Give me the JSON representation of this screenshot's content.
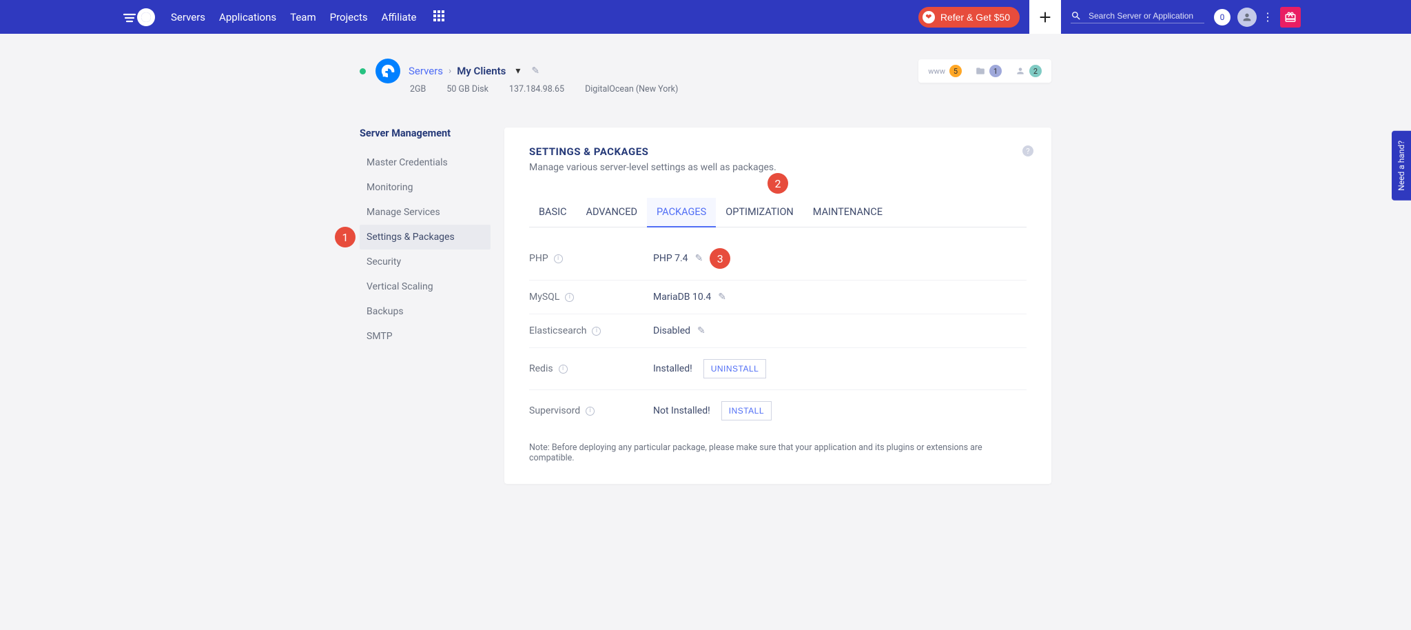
{
  "nav": {
    "items": [
      "Servers",
      "Applications",
      "Team",
      "Projects",
      "Affiliate"
    ],
    "refer": "Refer & Get $50",
    "search_placeholder": "Search Server or Application",
    "badge_count": "0"
  },
  "server": {
    "breadcrumb": {
      "root": "Servers",
      "current": "My Clients"
    },
    "stats": {
      "ram": "2GB",
      "disk": "50 GB Disk",
      "ip": "137.184.98.65",
      "provider": "DigitalOcean (New York)"
    },
    "header_badges": {
      "www_label": "www",
      "www_count": "5",
      "projects_count": "1",
      "users_count": "2"
    }
  },
  "sidebar": {
    "title": "Server Management",
    "items": [
      "Master Credentials",
      "Monitoring",
      "Manage Services",
      "Settings & Packages",
      "Security",
      "Vertical Scaling",
      "Backups",
      "SMTP"
    ],
    "active_index": 3
  },
  "card": {
    "title": "SETTINGS & PACKAGES",
    "subtitle": "Manage various server-level settings as well as packages."
  },
  "tabs": {
    "items": [
      "BASIC",
      "ADVANCED",
      "PACKAGES",
      "OPTIMIZATION",
      "MAINTENANCE"
    ],
    "active_index": 2
  },
  "packages": {
    "php": {
      "label": "PHP",
      "value": "PHP 7.4"
    },
    "mysql": {
      "label": "MySQL",
      "value": "MariaDB 10.4"
    },
    "elasticsearch": {
      "label": "Elasticsearch",
      "value": "Disabled"
    },
    "redis": {
      "label": "Redis",
      "value": "Installed!",
      "button": "UNINSTALL"
    },
    "supervisord": {
      "label": "Supervisord",
      "value": "Not Installed!",
      "button": "INSTALL"
    }
  },
  "note_prefix": "Note:",
  "note_body": " Before deploying any particular package, please make sure that your application and its plugins or extensions are compatible.",
  "annotations": {
    "a1": "1",
    "a2": "2",
    "a3": "3"
  },
  "help_tab": "Need a hand?"
}
